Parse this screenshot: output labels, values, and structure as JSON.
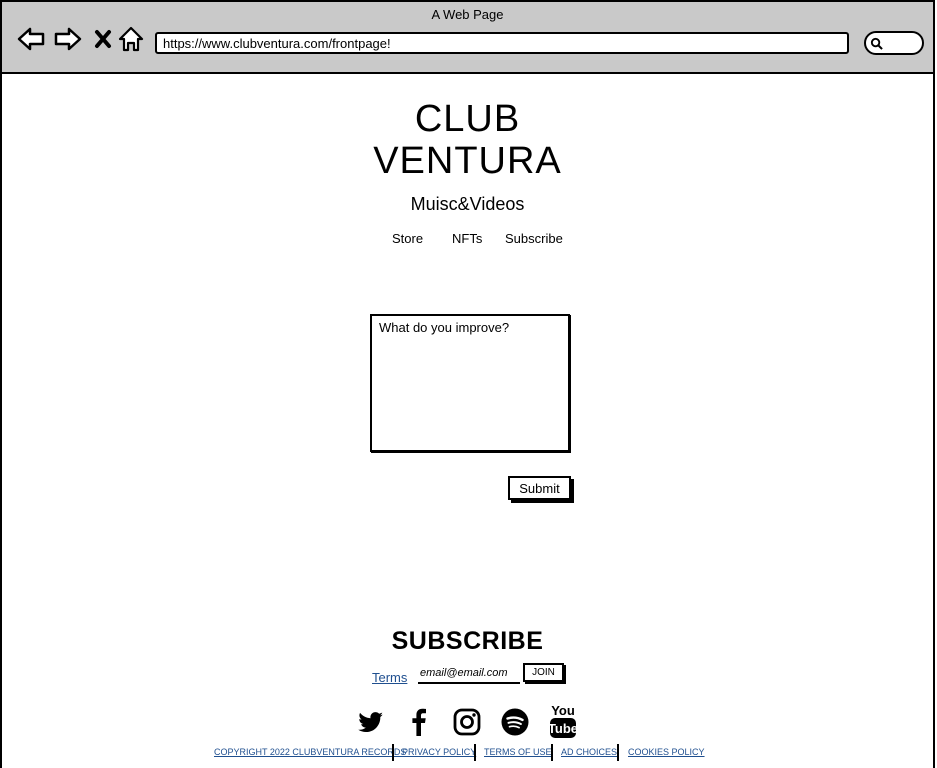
{
  "browser": {
    "title": "A Web Page",
    "url": "https://www.clubventura.com/frontpage!",
    "icons": [
      "back-arrow-icon",
      "forward-arrow-icon",
      "close-icon",
      "home-icon",
      "search-icon"
    ]
  },
  "header": {
    "brand_line1": "CLUB",
    "brand_line2": "VENTURA",
    "tagline": "Muisc&Videos"
  },
  "nav": {
    "items": [
      {
        "label": "Store"
      },
      {
        "label": "NFTs"
      },
      {
        "label": "Subscribe"
      }
    ]
  },
  "feedback": {
    "placeholder": "What do you improve?",
    "submit_label": "Submit"
  },
  "subscribe": {
    "heading": "SUBSCRIBE",
    "terms_label": "Terms",
    "email_placeholder": "email@email.com",
    "join_label": "JOIN"
  },
  "social": {
    "icons": [
      "twitter-icon",
      "facebook-icon",
      "instagram-icon",
      "spotify-icon",
      "youtube-icon"
    ]
  },
  "footer": {
    "links": [
      {
        "label": "COPYRIGHT 2022 CLUBVENTURA RECORDS"
      },
      {
        "label": "PRIVACY POLICY"
      },
      {
        "label": "TERMS OF USE"
      },
      {
        "label": "AD CHOICES"
      },
      {
        "label": "COOKIES POLICY"
      }
    ],
    "link_color": "#1f4f8f"
  }
}
